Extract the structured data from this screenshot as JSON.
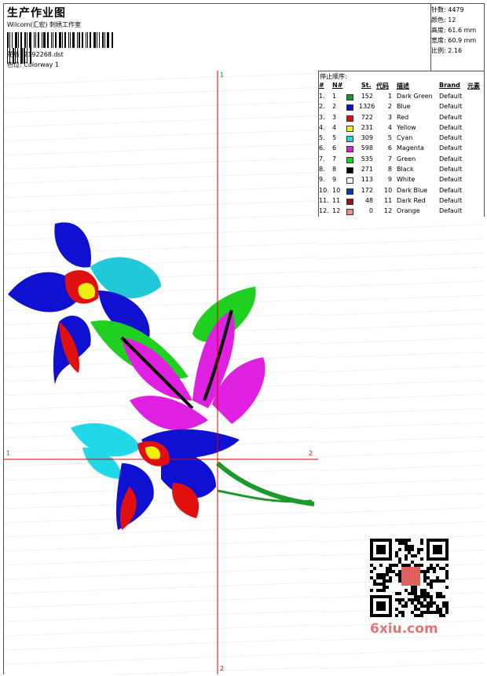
{
  "header": {
    "title": "生产作业图",
    "subtitle": "Wilcom(汇宏) 刺绣工作室",
    "file_label": "花版:",
    "file_name": "2192268.dst",
    "colorway_label": "色位:",
    "colorway": "Colorway 1"
  },
  "stats": [
    {
      "label": "针数:",
      "value": "4479"
    },
    {
      "label": "颜色:",
      "value": "12"
    },
    {
      "label": "高度:",
      "value": "61.6 mm"
    },
    {
      "label": "宽度:",
      "value": "60.9 mm"
    },
    {
      "label": "比例:",
      "value": "2.16"
    }
  ],
  "axes": {
    "top": "1",
    "bottom": "2",
    "left": "1",
    "right": "2"
  },
  "color_table": {
    "stop_title": "停止顺序:",
    "headers": {
      "hash": "#",
      "no": "N#",
      "st": "St.",
      "code": "代码",
      "desc": "描述",
      "brand": "Brand",
      "elem": "元素"
    },
    "rows": [
      {
        "idx": "1.",
        "no": "1",
        "color": "#1a9a2a",
        "st": "152",
        "code": "1",
        "desc": "Dark Green",
        "brand": "Default"
      },
      {
        "idx": "2.",
        "no": "2",
        "color": "#1010d0",
        "st": "1326",
        "code": "2",
        "desc": "Blue",
        "brand": "Default"
      },
      {
        "idx": "3.",
        "no": "3",
        "color": "#e01010",
        "st": "722",
        "code": "3",
        "desc": "Red",
        "brand": "Default"
      },
      {
        "idx": "4.",
        "no": "4",
        "color": "#f0f010",
        "st": "231",
        "code": "4",
        "desc": "Yellow",
        "brand": "Default"
      },
      {
        "idx": "5.",
        "no": "5",
        "color": "#20d8e8",
        "st": "309",
        "code": "5",
        "desc": "Cyan",
        "brand": "Default"
      },
      {
        "idx": "6.",
        "no": "6",
        "color": "#e020e0",
        "st": "598",
        "code": "6",
        "desc": "Magenta",
        "brand": "Default"
      },
      {
        "idx": "7.",
        "no": "7",
        "color": "#20d020",
        "st": "535",
        "code": "7",
        "desc": "Green",
        "brand": "Default"
      },
      {
        "idx": "8.",
        "no": "8",
        "color": "#000000",
        "st": "271",
        "code": "8",
        "desc": "Black",
        "brand": "Default"
      },
      {
        "idx": "9.",
        "no": "9",
        "color": "#f4f4f4",
        "st": "113",
        "code": "9",
        "desc": "White",
        "brand": "Default"
      },
      {
        "idx": "10.",
        "no": "10",
        "color": "#1030c0",
        "st": "172",
        "code": "10",
        "desc": "Dark Blue",
        "brand": "Default"
      },
      {
        "idx": "11.",
        "no": "11",
        "color": "#a01010",
        "st": "48",
        "code": "11",
        "desc": "Dark Red",
        "brand": "Default"
      },
      {
        "idx": "12.",
        "no": "12",
        "color": "#f09080",
        "st": "0",
        "code": "12",
        "desc": "Orange",
        "brand": "Default"
      }
    ]
  },
  "watermark": "6xiu.com"
}
